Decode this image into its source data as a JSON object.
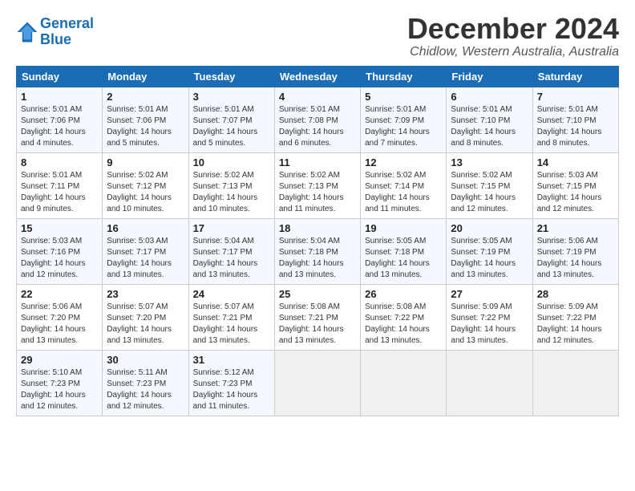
{
  "logo": {
    "line1": "General",
    "line2": "Blue"
  },
  "title": "December 2024",
  "subtitle": "Chidlow, Western Australia, Australia",
  "weekdays": [
    "Sunday",
    "Monday",
    "Tuesday",
    "Wednesday",
    "Thursday",
    "Friday",
    "Saturday"
  ],
  "weeks": [
    [
      {
        "day": 1,
        "sunrise": "5:01 AM",
        "sunset": "7:06 PM",
        "daylight": "14 hours and 4 minutes."
      },
      {
        "day": 2,
        "sunrise": "5:01 AM",
        "sunset": "7:06 PM",
        "daylight": "14 hours and 5 minutes."
      },
      {
        "day": 3,
        "sunrise": "5:01 AM",
        "sunset": "7:07 PM",
        "daylight": "14 hours and 5 minutes."
      },
      {
        "day": 4,
        "sunrise": "5:01 AM",
        "sunset": "7:08 PM",
        "daylight": "14 hours and 6 minutes."
      },
      {
        "day": 5,
        "sunrise": "5:01 AM",
        "sunset": "7:09 PM",
        "daylight": "14 hours and 7 minutes."
      },
      {
        "day": 6,
        "sunrise": "5:01 AM",
        "sunset": "7:10 PM",
        "daylight": "14 hours and 8 minutes."
      },
      {
        "day": 7,
        "sunrise": "5:01 AM",
        "sunset": "7:10 PM",
        "daylight": "14 hours and 8 minutes."
      }
    ],
    [
      {
        "day": 8,
        "sunrise": "5:01 AM",
        "sunset": "7:11 PM",
        "daylight": "14 hours and 9 minutes."
      },
      {
        "day": 9,
        "sunrise": "5:02 AM",
        "sunset": "7:12 PM",
        "daylight": "14 hours and 10 minutes."
      },
      {
        "day": 10,
        "sunrise": "5:02 AM",
        "sunset": "7:13 PM",
        "daylight": "14 hours and 10 minutes."
      },
      {
        "day": 11,
        "sunrise": "5:02 AM",
        "sunset": "7:13 PM",
        "daylight": "14 hours and 11 minutes."
      },
      {
        "day": 12,
        "sunrise": "5:02 AM",
        "sunset": "7:14 PM",
        "daylight": "14 hours and 11 minutes."
      },
      {
        "day": 13,
        "sunrise": "5:02 AM",
        "sunset": "7:15 PM",
        "daylight": "14 hours and 12 minutes."
      },
      {
        "day": 14,
        "sunrise": "5:03 AM",
        "sunset": "7:15 PM",
        "daylight": "14 hours and 12 minutes."
      }
    ],
    [
      {
        "day": 15,
        "sunrise": "5:03 AM",
        "sunset": "7:16 PM",
        "daylight": "14 hours and 12 minutes."
      },
      {
        "day": 16,
        "sunrise": "5:03 AM",
        "sunset": "7:17 PM",
        "daylight": "14 hours and 13 minutes."
      },
      {
        "day": 17,
        "sunrise": "5:04 AM",
        "sunset": "7:17 PM",
        "daylight": "14 hours and 13 minutes."
      },
      {
        "day": 18,
        "sunrise": "5:04 AM",
        "sunset": "7:18 PM",
        "daylight": "14 hours and 13 minutes."
      },
      {
        "day": 19,
        "sunrise": "5:05 AM",
        "sunset": "7:18 PM",
        "daylight": "14 hours and 13 minutes."
      },
      {
        "day": 20,
        "sunrise": "5:05 AM",
        "sunset": "7:19 PM",
        "daylight": "14 hours and 13 minutes."
      },
      {
        "day": 21,
        "sunrise": "5:06 AM",
        "sunset": "7:19 PM",
        "daylight": "14 hours and 13 minutes."
      }
    ],
    [
      {
        "day": 22,
        "sunrise": "5:06 AM",
        "sunset": "7:20 PM",
        "daylight": "14 hours and 13 minutes."
      },
      {
        "day": 23,
        "sunrise": "5:07 AM",
        "sunset": "7:20 PM",
        "daylight": "14 hours and 13 minutes."
      },
      {
        "day": 24,
        "sunrise": "5:07 AM",
        "sunset": "7:21 PM",
        "daylight": "14 hours and 13 minutes."
      },
      {
        "day": 25,
        "sunrise": "5:08 AM",
        "sunset": "7:21 PM",
        "daylight": "14 hours and 13 minutes."
      },
      {
        "day": 26,
        "sunrise": "5:08 AM",
        "sunset": "7:22 PM",
        "daylight": "14 hours and 13 minutes."
      },
      {
        "day": 27,
        "sunrise": "5:09 AM",
        "sunset": "7:22 PM",
        "daylight": "14 hours and 13 minutes."
      },
      {
        "day": 28,
        "sunrise": "5:09 AM",
        "sunset": "7:22 PM",
        "daylight": "14 hours and 12 minutes."
      }
    ],
    [
      {
        "day": 29,
        "sunrise": "5:10 AM",
        "sunset": "7:23 PM",
        "daylight": "14 hours and 12 minutes."
      },
      {
        "day": 30,
        "sunrise": "5:11 AM",
        "sunset": "7:23 PM",
        "daylight": "14 hours and 12 minutes."
      },
      {
        "day": 31,
        "sunrise": "5:12 AM",
        "sunset": "7:23 PM",
        "daylight": "14 hours and 11 minutes."
      },
      null,
      null,
      null,
      null
    ]
  ]
}
